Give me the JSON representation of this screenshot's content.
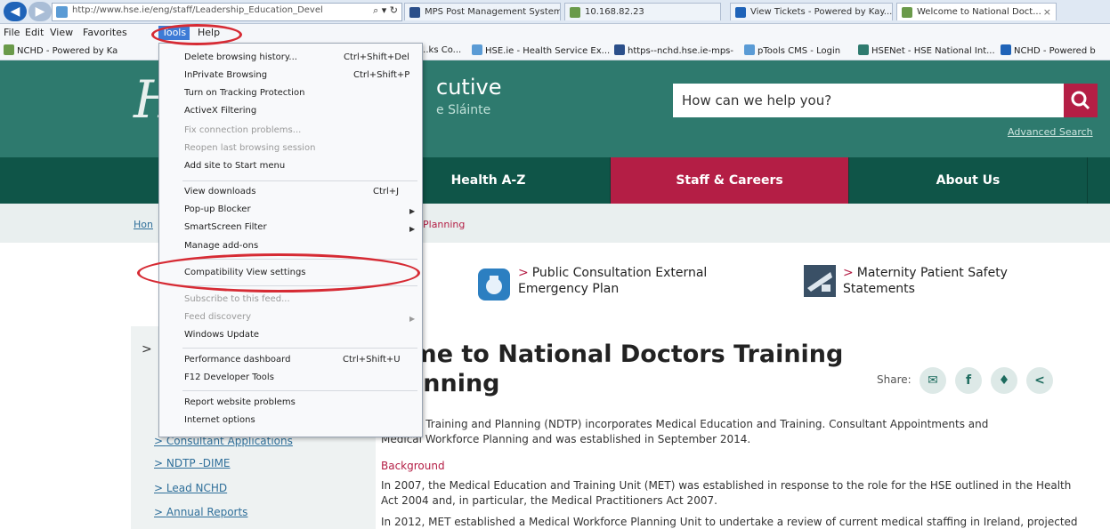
{
  "browser": {
    "address_url": "http://www.hse.ie/eng/staff/Leadership_Education_Devel",
    "address_controls": "⌕ ▾ ↻",
    "tabs": [
      {
        "label": "MPS Post Management System"
      },
      {
        "label": "10.168.82.23"
      },
      {
        "label": "View Tickets - Powered by Kay..."
      },
      {
        "label": "Welcome to National Doct...",
        "close": "×"
      }
    ],
    "menus": [
      "File",
      "Edit",
      "View",
      "Favorites",
      "Tools",
      "Help"
    ],
    "favorites": [
      "NCHD - Powered by Ka",
      "...ks Co...",
      "HSE.ie - Health Service Ex...",
      "https--nchd.hse.ie-mps-",
      "pTools CMS - Login",
      "HSENet - HSE National Int...",
      "NCHD - Powered b"
    ]
  },
  "tools_menu": {
    "items": [
      {
        "label": "Delete browsing history...",
        "shortcut": "Ctrl+Shift+Del"
      },
      {
        "label": "InPrivate Browsing",
        "shortcut": "Ctrl+Shift+P"
      },
      {
        "label": "Turn on Tracking Protection"
      },
      {
        "label": "ActiveX Filtering"
      },
      {
        "label": "Fix connection problems...",
        "disabled": true
      },
      {
        "label": "Reopen last browsing session",
        "disabled": true
      },
      {
        "label": "Add site to Start menu"
      },
      {
        "label": "View downloads",
        "shortcut": "Ctrl+J"
      },
      {
        "label": "Pop-up Blocker",
        "submenu": true
      },
      {
        "label": "SmartScreen Filter",
        "submenu": true
      },
      {
        "label": "Manage add-ons"
      },
      {
        "label": "Compatibility View settings"
      },
      {
        "label": "Subscribe to this feed...",
        "disabled": true
      },
      {
        "label": "Feed discovery",
        "disabled": true,
        "submenu": true
      },
      {
        "label": "Windows Update"
      },
      {
        "label": "Performance dashboard",
        "shortcut": "Ctrl+Shift+U"
      },
      {
        "label": "F12 Developer Tools"
      },
      {
        "label": "Report website problems"
      },
      {
        "label": "Internet options"
      }
    ]
  },
  "site": {
    "brand": "cutive",
    "brand_sub": "e Sláinte",
    "logo_letter": "H",
    "search": {
      "placeholder": "How can we help you?"
    },
    "advanced_search": "Advanced Search",
    "nav": [
      "Health A-Z",
      "Staff & Careers",
      "About Us"
    ],
    "breadcrumb": {
      "home": "Hon",
      "current": "Planning"
    },
    "promos": [
      {
        "label": "Public Consultation External Emergency Plan",
        "line1": "Public Consultation External",
        "line2": "Emergency Plan"
      },
      {
        "label": "Maternity Patient Safety Statements",
        "line1": "Maternity Patient Safety",
        "line2": "Statements"
      }
    ],
    "heading_line1": "come to National Doctors Training",
    "heading_line2": "Planning",
    "share_label": "Share:",
    "side_chevron": ">",
    "side_links": [
      "Consultant Applications",
      "NDTP -DIME",
      "Lead NCHD",
      "Annual Reports"
    ],
    "intro": "Doctors Training and Planning (NDTP) incorporates Medical Education and Training. Consultant Appointments and",
    "intro2": "Medical Workforce Planning and was established in September 2014.",
    "background_heading": "Background",
    "bg_para1": "In 2007, the Medical Education and Training Unit (MET) was established in response to the role for the HSE outlined in the Health",
    "bg_para2": "Act 2004 and, in particular, the Medical Practitioners Act 2007.",
    "bg_para3": "In 2012, MET established a Medical Workforce Planning Unit to undertake a review of current medical staffing in Ireland, projected"
  },
  "colors": {
    "brand_green": "#2e7a6e",
    "nav_green": "#0f5548",
    "accent_red": "#b41e45",
    "annotation_red": "#d62b34"
  }
}
